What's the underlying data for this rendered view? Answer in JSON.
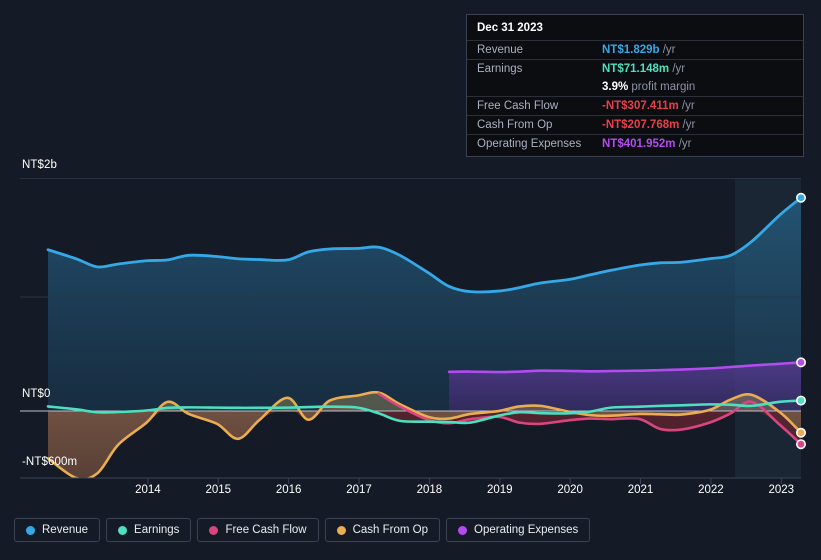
{
  "tooltip": {
    "date": "Dec 31 2023",
    "rows": [
      {
        "key": "Revenue",
        "value": "NT$1.829b",
        "unit": "/yr",
        "color": "#35a9e8"
      },
      {
        "key": "Earnings",
        "value": "NT$71.148m",
        "unit": "/yr",
        "color": "#4de0c0"
      },
      {
        "key": "",
        "value": "3.9%",
        "unit": "profit margin",
        "color": "#ffffff"
      },
      {
        "key": "Free Cash Flow",
        "value": "-NT$307.411m",
        "unit": "/yr",
        "color": "#e8404a"
      },
      {
        "key": "Cash From Op",
        "value": "-NT$207.768m",
        "unit": "/yr",
        "color": "#e8404a"
      },
      {
        "key": "Operating Expenses",
        "value": "NT$401.952m",
        "unit": "/yr",
        "color": "#b44bf0"
      }
    ]
  },
  "legend": [
    {
      "label": "Revenue",
      "color": "#35a9e8"
    },
    {
      "label": "Earnings",
      "color": "#4de0c0"
    },
    {
      "label": "Free Cash Flow",
      "color": "#d9457f"
    },
    {
      "label": "Cash From Op",
      "color": "#eaad51"
    },
    {
      "label": "Operating Expenses",
      "color": "#b44bf0"
    }
  ],
  "axes": {
    "y_top_label": "NT$2b",
    "y_zero_label": "NT$0",
    "y_bottom_label": "-NT$600m",
    "x_ticks": [
      "2014",
      "2015",
      "2016",
      "2017",
      "2018",
      "2019",
      "2020",
      "2021",
      "2022",
      "2023"
    ]
  },
  "chart_data": {
    "type": "line",
    "title": "",
    "xlabel": "",
    "ylabel": "",
    "ylim": [
      -600,
      2000
    ],
    "y_unit": "NT$ millions",
    "y_ticks": [
      2000,
      1000,
      0,
      -600
    ],
    "grid": true,
    "legend_position": "bottom-left",
    "x": [
      2013.3,
      2013.7,
      2014.0,
      2014.3,
      2014.7,
      2015.0,
      2015.3,
      2015.7,
      2016.0,
      2016.3,
      2016.7,
      2017.0,
      2017.3,
      2017.7,
      2018.0,
      2018.3,
      2018.7,
      2019.0,
      2019.3,
      2019.7,
      2020.0,
      2020.3,
      2020.7,
      2021.0,
      2021.3,
      2021.7,
      2022.0,
      2022.3,
      2022.7,
      2023.0,
      2023.3,
      2023.7,
      2024.0
    ],
    "series": [
      {
        "name": "Revenue",
        "color": "#35a9e8",
        "values": [
          1378,
          1300,
          1230,
          1255,
          1283,
          1290,
          1330,
          1320,
          1300,
          1293,
          1290,
          1360,
          1385,
          1390,
          1400,
          1330,
          1180,
          1060,
          1015,
          1020,
          1050,
          1090,
          1120,
          1160,
          1200,
          1245,
          1265,
          1270,
          1300,
          1330,
          1450,
          1680,
          1829
        ]
      },
      {
        "name": "Earnings",
        "color": "#4de0c0",
        "values": [
          20,
          -5,
          -30,
          -28,
          -15,
          8,
          12,
          10,
          8,
          8,
          10,
          15,
          18,
          10,
          -40,
          -105,
          -112,
          -115,
          -120,
          -60,
          -30,
          -38,
          -40,
          -25,
          10,
          18,
          25,
          30,
          38,
          35,
          25,
          60,
          71
        ]
      },
      {
        "name": "Free Cash Flow",
        "color": "#d9457f",
        "values": [
          null,
          null,
          null,
          null,
          null,
          null,
          null,
          null,
          null,
          null,
          null,
          null,
          null,
          null,
          130,
          20,
          -95,
          -125,
          -90,
          -70,
          -120,
          -130,
          -100,
          -85,
          -90,
          -88,
          -175,
          -180,
          -120,
          -40,
          60,
          -140,
          -307
        ]
      },
      {
        "name": "Cash From Op",
        "color": "#eaad51",
        "values": [
          -430,
          -600,
          -560,
          -310,
          -120,
          60,
          -45,
          -130,
          -260,
          -100,
          95,
          -95,
          70,
          115,
          140,
          40,
          -70,
          -85,
          -45,
          -20,
          20,
          25,
          -25,
          -55,
          -60,
          -45,
          -48,
          -50,
          -10,
          80,
          120,
          -30,
          -208
        ]
      },
      {
        "name": "Operating Expenses",
        "color": "#b44bf0",
        "values": [
          null,
          null,
          null,
          null,
          null,
          null,
          null,
          null,
          null,
          null,
          null,
          null,
          null,
          null,
          null,
          null,
          null,
          320,
          322,
          318,
          322,
          330,
          328,
          325,
          327,
          330,
          335,
          340,
          350,
          362,
          375,
          390,
          402
        ]
      }
    ]
  }
}
